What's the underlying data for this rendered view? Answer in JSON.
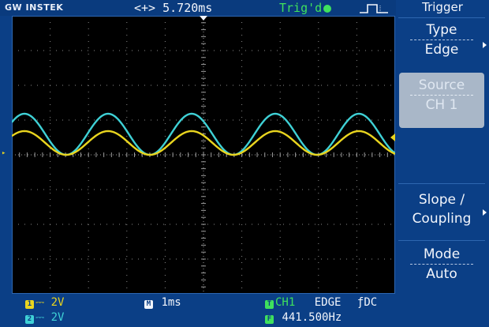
{
  "topbar": {
    "brand": "GW INSTEK",
    "time_position": "5.720ms",
    "time_position_icon": "horizontal-position-arrows-icon",
    "trigger_status": "Trig'd",
    "trigger_status_icon": "trigger-dot-icon",
    "trigger_edge_icon": "rising-edge-icon"
  },
  "menu": {
    "title": "Trigger",
    "buttons": [
      {
        "line1": "Type",
        "line2": "Edge",
        "selected": false
      },
      {
        "line1": "Source",
        "line2": "CH 1",
        "selected": true
      },
      {
        "line1": "Slope /",
        "line2": "Coupling",
        "selected": false
      },
      {
        "line1": "Mode",
        "line2": "Auto",
        "selected": false
      }
    ]
  },
  "status": {
    "ch1_tag": "1",
    "ch1_scale": "2V",
    "ch2_tag": "2",
    "ch2_scale": "2V",
    "timebase_tag": "M",
    "timebase": "1ms",
    "trigger_tag": "T",
    "trigger_source": "CH1",
    "trigger_type": "EDGE",
    "trigger_coupling": "DC",
    "frequency_tag": "F",
    "frequency": "441.500Hz"
  },
  "colors": {
    "ch1": "#e9d51f",
    "ch2": "#3fd1d6",
    "background": "#0b3f86",
    "trigger_green": "#3fe15d"
  },
  "waveforms": {
    "cycles_visible": 4,
    "ch1_label": "1",
    "ch2_label": "2"
  }
}
